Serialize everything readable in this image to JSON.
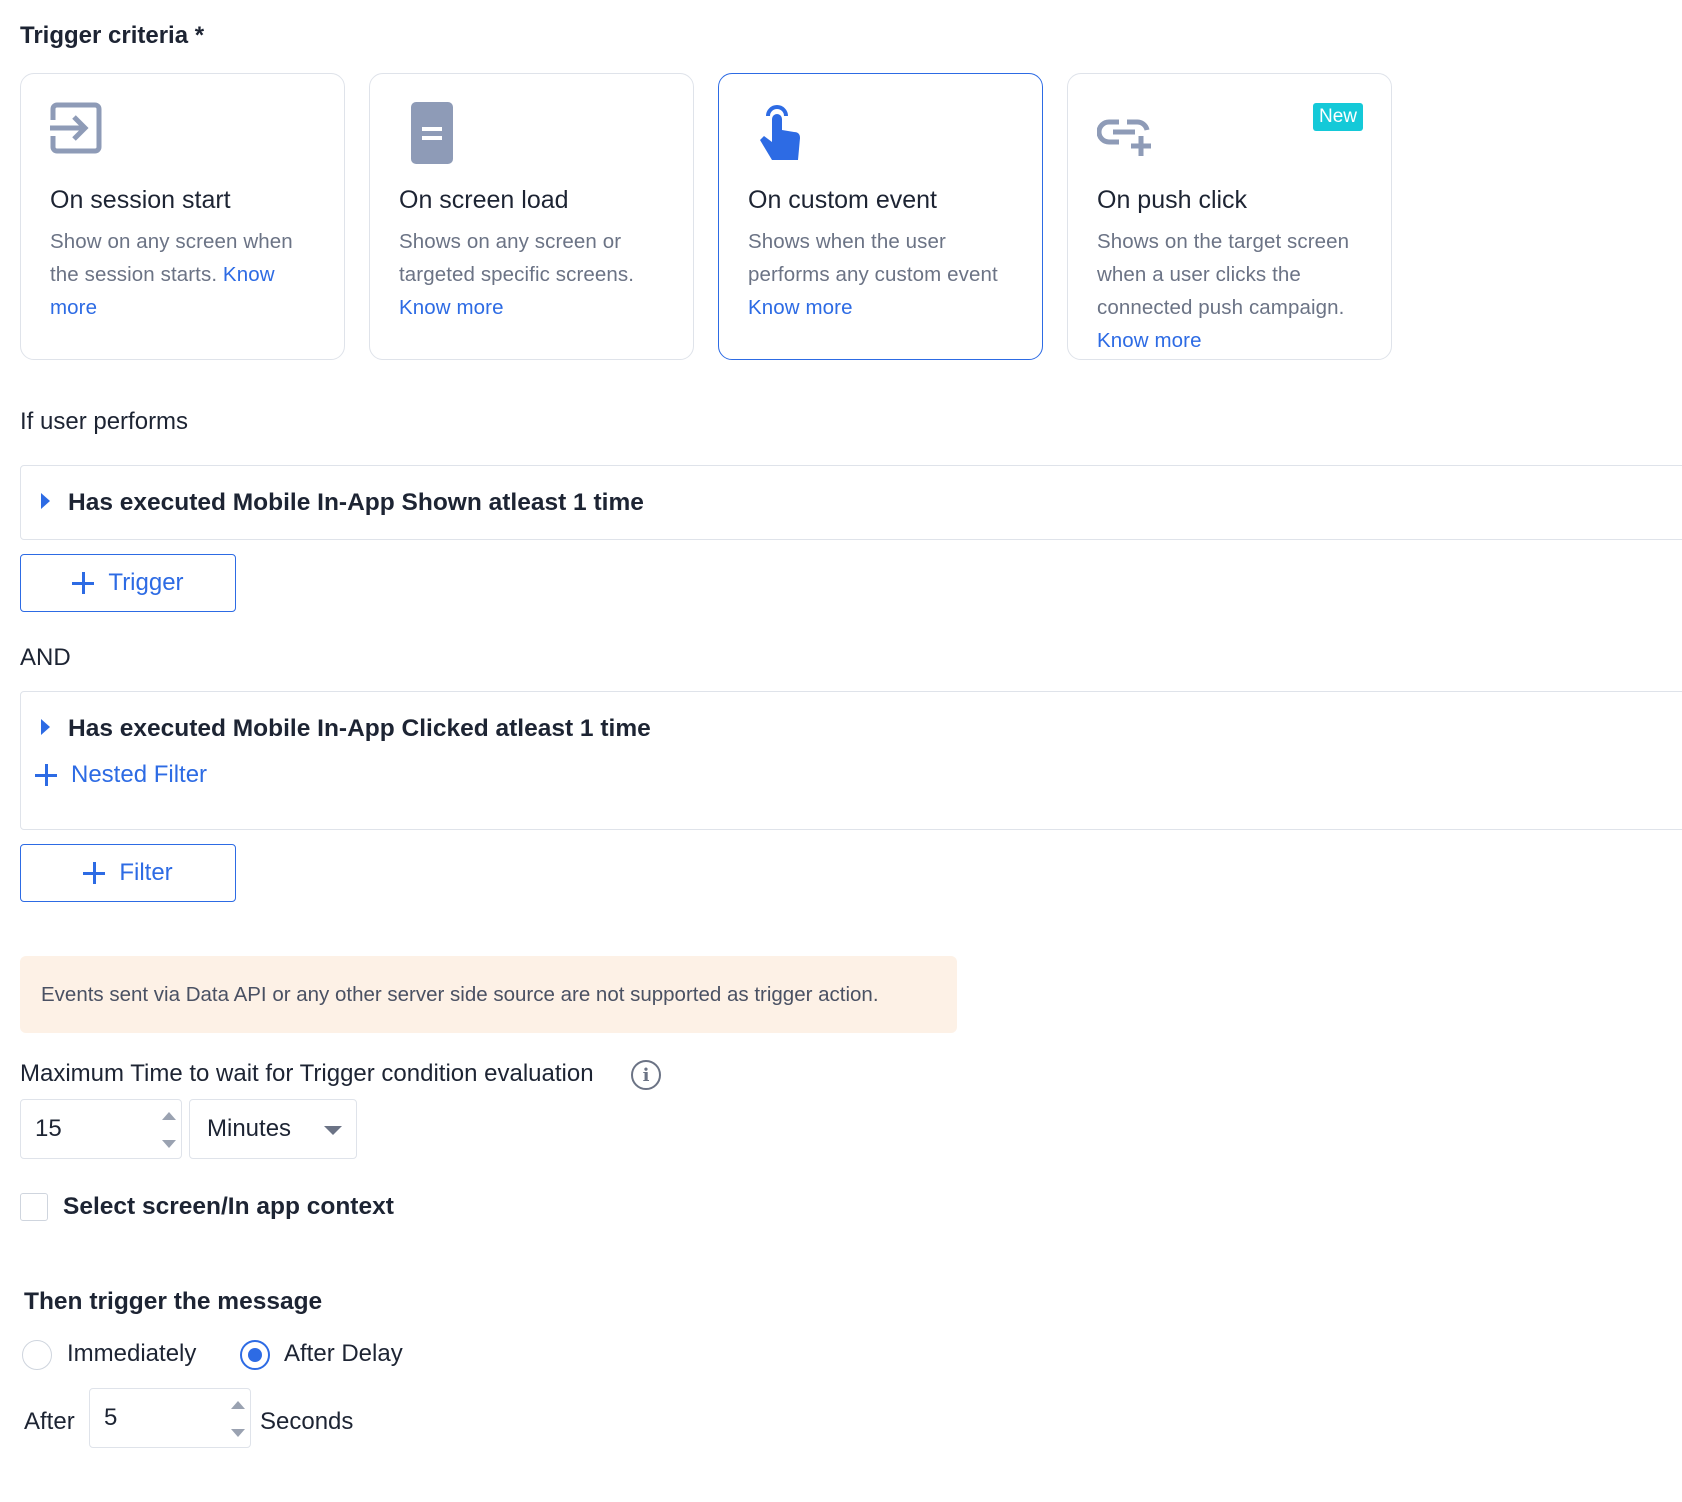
{
  "trigger_criteria": {
    "title": "Trigger criteria *",
    "cards": [
      {
        "icon": "session-enter-icon",
        "title": "On session start",
        "desc": "Show on any screen when the session starts.",
        "link": "Know more"
      },
      {
        "icon": "screen-icon",
        "title": "On screen load",
        "desc": "Shows on any screen or targeted specific screens.",
        "link": "Know more"
      },
      {
        "icon": "tap-finger-icon",
        "title": "On custom event",
        "desc": "Shows when the user performs any custom event",
        "link": "Know more",
        "selected": true
      },
      {
        "icon": "push-link-icon",
        "title": "On push click",
        "desc": "Shows on the target screen when a user clicks the connected push campaign.",
        "link": "Know more",
        "badge": "New"
      }
    ]
  },
  "user_performs": {
    "label": "If user performs",
    "trigger_filter": "Has executed Mobile In-App Shown atleast 1 time",
    "add_trigger_label": "Trigger",
    "and_label": "AND",
    "and_filter": "Has executed Mobile In-App Clicked atleast 1 time",
    "nested_filter_label": "Nested Filter",
    "add_filter_label": "Filter"
  },
  "notice": "Events sent via Data API or any other server side source are not supported as trigger action.",
  "max_wait": {
    "label": "Maximum Time to wait for Trigger condition evaluation",
    "value": "15",
    "unit": "Minutes"
  },
  "context_checkbox": {
    "label": "Select screen/In app context",
    "checked": false
  },
  "then_trigger": {
    "title": "Then trigger the message",
    "options": [
      "Immediately",
      "After Delay"
    ],
    "selected": "After Delay",
    "after_label": "After",
    "delay_value": "5",
    "delay_unit": "Seconds"
  },
  "colors": {
    "accent": "#2d6be4",
    "badge": "#14c9d8",
    "notice_bg": "#fdf1e6"
  }
}
